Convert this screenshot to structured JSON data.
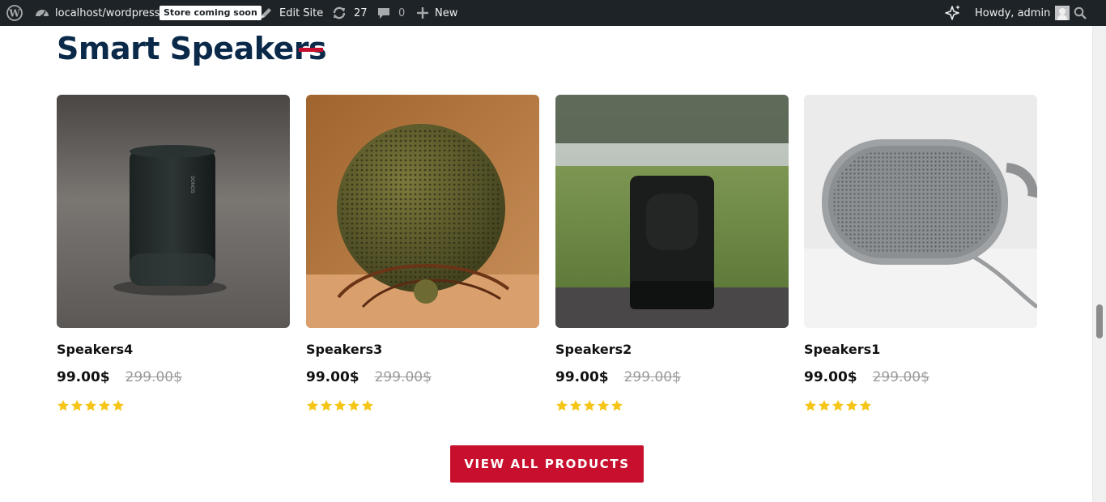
{
  "adminbar": {
    "site_link": "localhost/wordpress",
    "store_badge": "Store coming soon",
    "edit_site": "Edit Site",
    "updates_count": "27",
    "comments_count": "0",
    "new_label": "New",
    "greeting": "Howdy, admin"
  },
  "section": {
    "title": "Smart Speakers"
  },
  "products": [
    {
      "name": "Speakers4",
      "price": "99.00$",
      "old_price": "299.00$",
      "rating": 5
    },
    {
      "name": "Speakers3",
      "price": "99.00$",
      "old_price": "299.00$",
      "rating": 5
    },
    {
      "name": "Speakers2",
      "price": "99.00$",
      "old_price": "299.00$",
      "rating": 5
    },
    {
      "name": "Speakers1",
      "price": "99.00$",
      "old_price": "299.00$",
      "rating": 5
    }
  ],
  "cta": {
    "label": "VIEW ALL PRODUCTS"
  },
  "colors": {
    "adminbar_bg": "#1d2327",
    "heading": "#0b2a4a",
    "accent": "#c8102e",
    "star": "#f5c518"
  },
  "icons": [
    "wordpress-icon",
    "dashboard-icon",
    "edit-site-icon",
    "updates-icon",
    "comments-icon",
    "plus-icon",
    "sparkle-icon",
    "search-icon",
    "star-icon"
  ]
}
